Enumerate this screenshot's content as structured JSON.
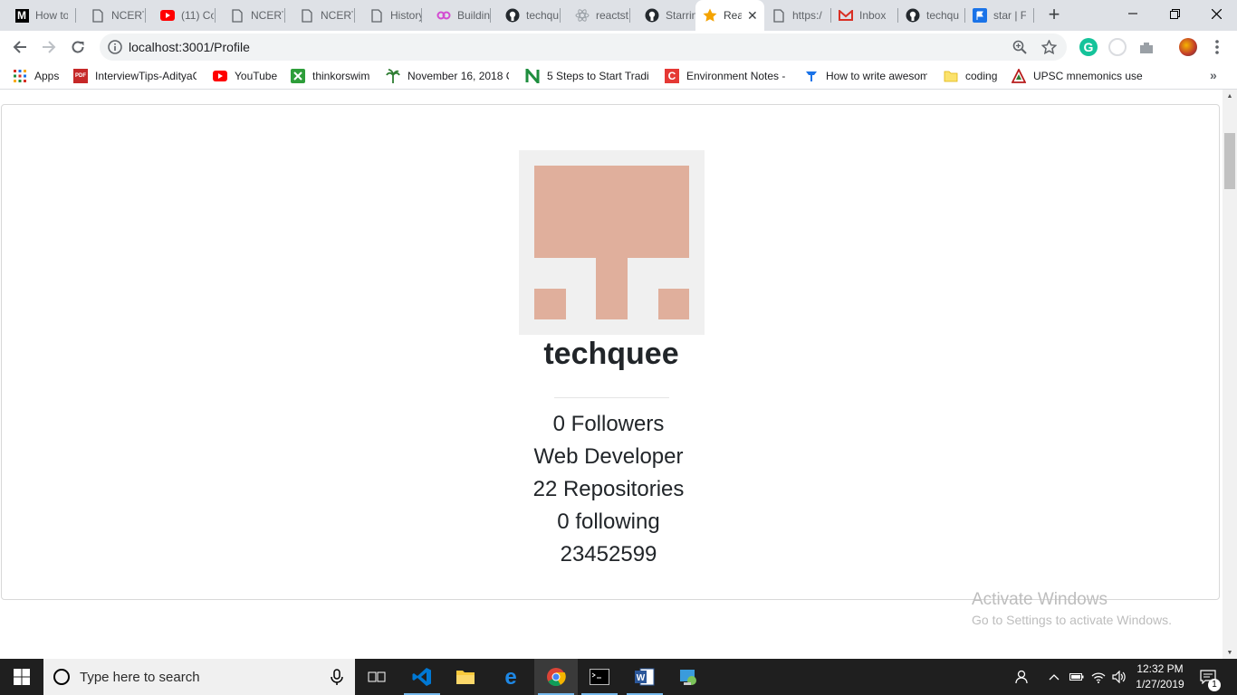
{
  "tabs": [
    {
      "label": "How to",
      "icon": "medium-icon"
    },
    {
      "label": "NCERT",
      "icon": "page-icon"
    },
    {
      "label": "(11) Co",
      "icon": "youtube-icon"
    },
    {
      "label": "NCERT",
      "icon": "page-icon"
    },
    {
      "label": "NCERT",
      "icon": "page-icon"
    },
    {
      "label": "History",
      "icon": "page-icon"
    },
    {
      "label": "Buildin",
      "icon": "link-icon"
    },
    {
      "label": "techqu",
      "icon": "github-icon"
    },
    {
      "label": "reactst",
      "icon": "react-icon"
    },
    {
      "label": "Starrin",
      "icon": "github-icon"
    },
    {
      "label": "Rea",
      "icon": "star-icon",
      "active": true
    },
    {
      "label": "https:/",
      "icon": "page-icon"
    },
    {
      "label": "Inbox",
      "icon": "gmail-icon"
    },
    {
      "label": "techqu",
      "icon": "github-icon"
    },
    {
      "label": "star | F",
      "icon": "flag-icon"
    }
  ],
  "address": {
    "url": "localhost:3001/Profile"
  },
  "bookmarks": [
    {
      "label": "Apps",
      "icon": "apps-grid-icon"
    },
    {
      "label": "InterviewTips-AdityaC",
      "icon": "pdf-icon"
    },
    {
      "label": "YouTube",
      "icon": "youtube-icon"
    },
    {
      "label": "thinkorswim",
      "icon": "thinkorswim-icon"
    },
    {
      "label": "November 16, 2018 C",
      "icon": "palm-icon"
    },
    {
      "label": "5 Steps to Start Tradin",
      "icon": "n-logo-icon"
    },
    {
      "label": "Environment Notes -",
      "icon": "c-logo-icon"
    },
    {
      "label": "How to write awesom",
      "icon": "bookmark-blue-icon"
    },
    {
      "label": "coding",
      "icon": "folder-icon"
    },
    {
      "label": "UPSC mnemonics use",
      "icon": "upsc-icon"
    }
  ],
  "profile": {
    "username": "techquee",
    "followers": "0 Followers",
    "bio": "Web Developer",
    "repositories": "22 Repositories",
    "following": "0 following",
    "id": "23452599",
    "avatar_color": "#e0af9c"
  },
  "watermark": {
    "line1": "Activate Windows",
    "line2": "Go to Settings to activate Windows."
  },
  "taskbar": {
    "search_placeholder": "Type here to search",
    "time": "12:32 PM",
    "date": "1/27/2019",
    "notification_count": "1"
  },
  "colors": {
    "accent": "#1a73e8",
    "taskbar": "#1f1f1f",
    "tabstrip": "#dee1e6"
  }
}
